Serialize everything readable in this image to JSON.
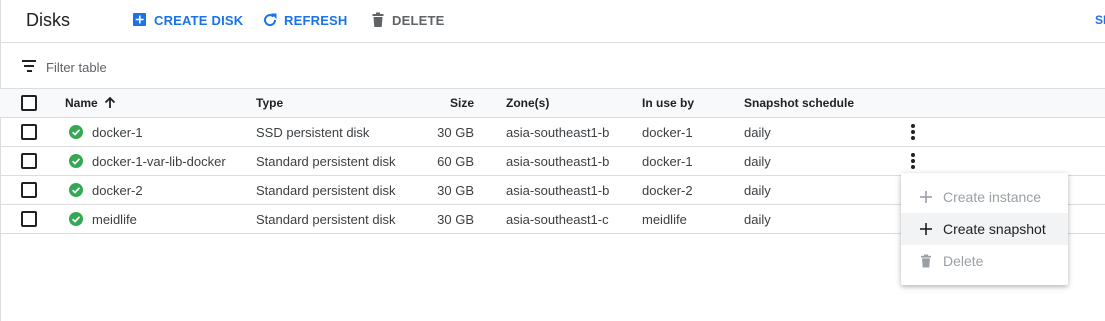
{
  "header": {
    "title": "Disks",
    "create_disk_label": "CREATE DISK",
    "refresh_label": "REFRESH",
    "delete_label": "DELETE",
    "truncated_label": "SI"
  },
  "filter": {
    "placeholder": "Filter table"
  },
  "table": {
    "columns": {
      "name": "Name",
      "type": "Type",
      "size": "Size",
      "zone": "Zone(s)",
      "in_use_by": "In use by",
      "snapshot_schedule": "Snapshot schedule"
    },
    "sort": "name-ascending",
    "rows": [
      {
        "name": "docker-1",
        "type": "SSD persistent disk",
        "size": "30 GB",
        "zone": "asia-southeast1-b",
        "in_use_by": "docker-1",
        "snapshot_schedule": "daily",
        "status": "ok"
      },
      {
        "name": "docker-1-var-lib-docker",
        "type": "Standard persistent disk",
        "size": "60 GB",
        "zone": "asia-southeast1-b",
        "in_use_by": "docker-1",
        "snapshot_schedule": "daily",
        "status": "ok"
      },
      {
        "name": "docker-2",
        "type": "Standard persistent disk",
        "size": "30 GB",
        "zone": "asia-southeast1-b",
        "in_use_by": "docker-2",
        "snapshot_schedule": "daily",
        "status": "ok"
      },
      {
        "name": "meidlife",
        "type": "Standard persistent disk",
        "size": "30 GB",
        "zone": "asia-southeast1-c",
        "in_use_by": "meidlife",
        "snapshot_schedule": "daily",
        "status": "ok"
      }
    ]
  },
  "context_menu": {
    "items": [
      {
        "label": "Create instance",
        "icon": "plus-icon",
        "enabled": false
      },
      {
        "label": "Create snapshot",
        "icon": "plus-icon",
        "enabled": true
      },
      {
        "label": "Delete",
        "icon": "trash-icon",
        "enabled": false
      }
    ]
  },
  "colors": {
    "accent": "#1a73e8",
    "status_ok": "#34a853",
    "disabled": "#9aa0a6",
    "border": "#dadce0"
  }
}
